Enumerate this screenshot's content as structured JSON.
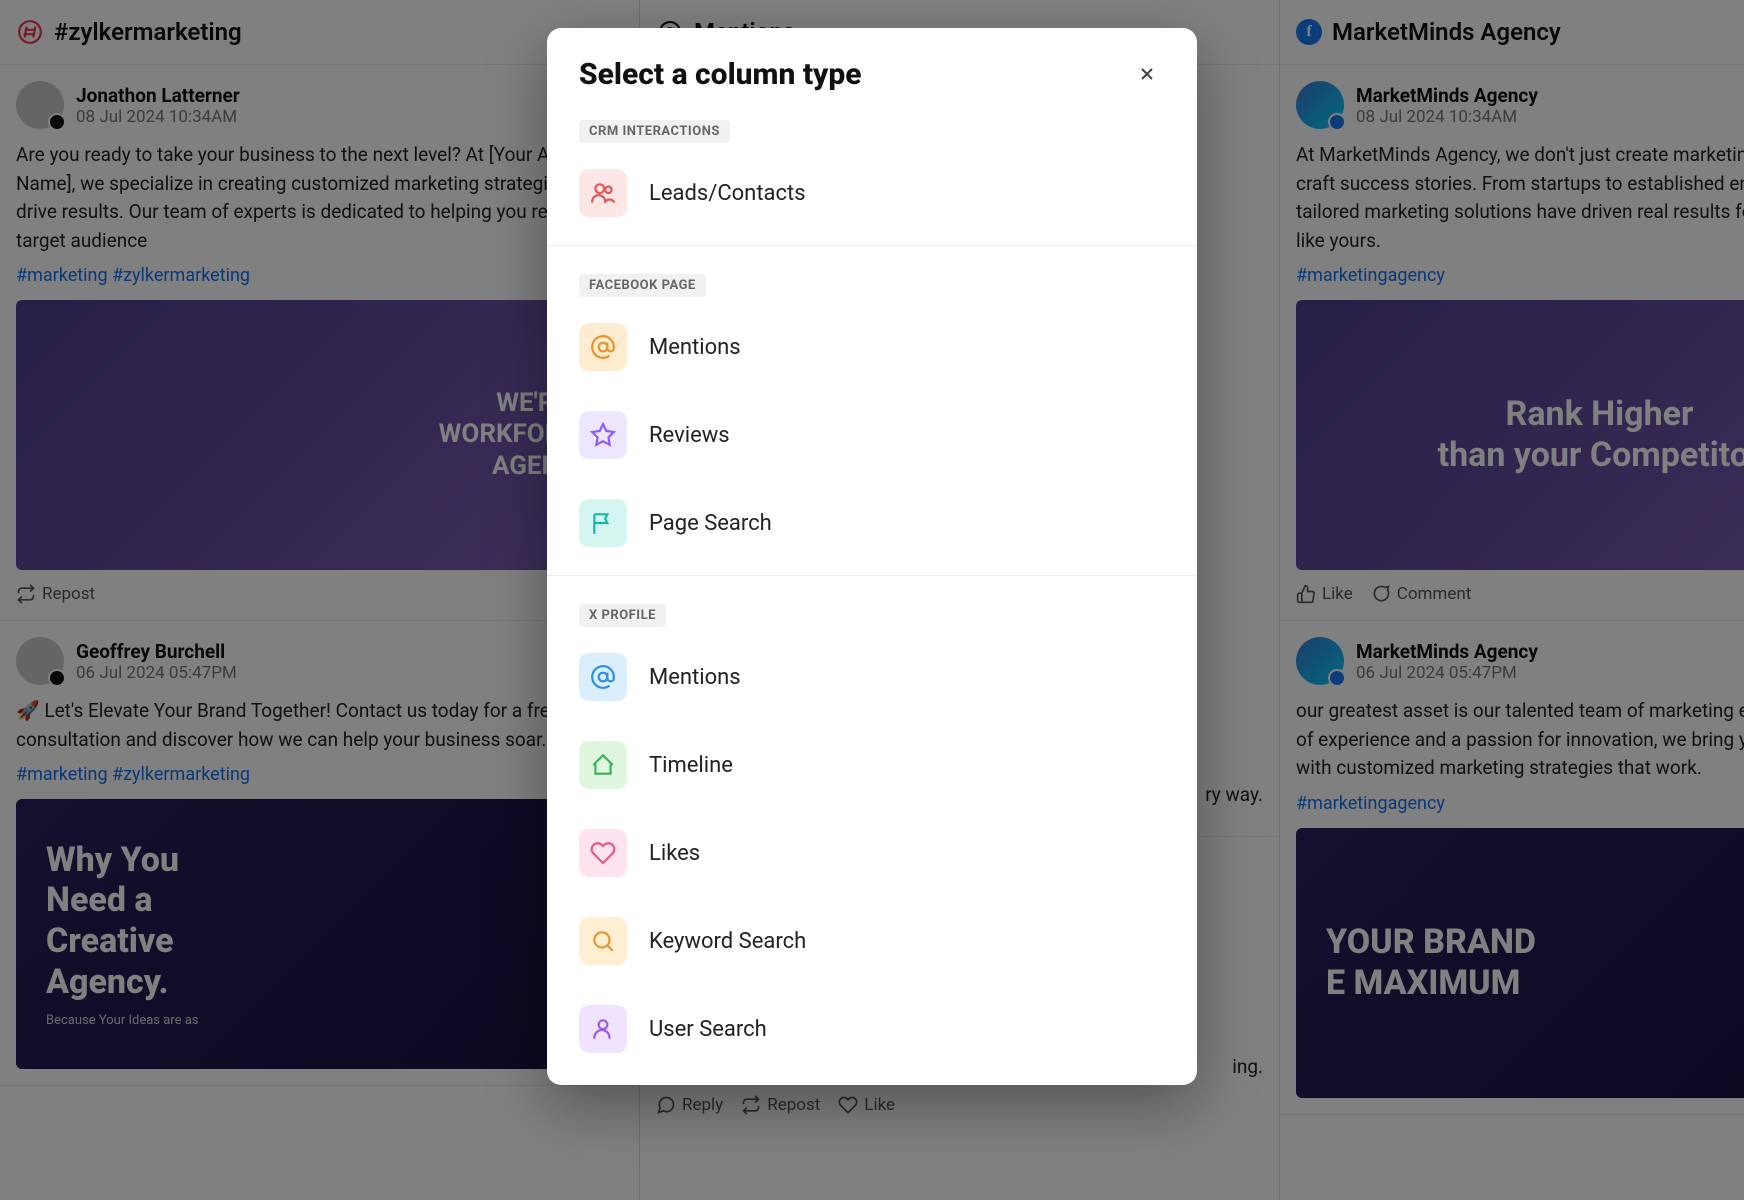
{
  "columns": [
    {
      "title": "#zylkermarketing",
      "icon": "hashtag-icon",
      "posts": [
        {
          "author": "Jonathon Latterner",
          "timestamp": "08 Jul 2024 10:34AM",
          "body": "Are you ready to take your business to the next level? At [Your Agency Name], we specialize in creating customized marketing strategies that drive results. Our team of experts is dedicated to helping you reach your target audience",
          "hashtags": "#marketing #zylkermarketing",
          "image_text": "WE'RE A\nWORKFORCE\nAGENCY",
          "actions": [
            {
              "icon": "repost-icon",
              "label": "Repost"
            }
          ]
        },
        {
          "author": "Geoffrey Burchell",
          "timestamp": "06 Jul 2024 05:47PM",
          "body": "🚀 Let's Elevate Your Brand Together! Contact us today for a free consultation and discover how we can help your business soar. 🌟",
          "hashtags": "#marketing #zylkermarketing",
          "image_text": "Why You\nNeed a\nCreative\nAgency.",
          "image_sub": "Because Your Ideas are as"
        }
      ]
    },
    {
      "title": "Mentions",
      "icon": "at-icon",
      "posts": [
        {
          "body_snippet_1": "ry way.",
          "body_snippet_2": "ing.",
          "actions": [
            {
              "icon": "reply-icon",
              "label": "Reply"
            },
            {
              "icon": "repost-icon",
              "label": "Repost"
            },
            {
              "icon": "like-icon",
              "label": "Like"
            }
          ]
        }
      ]
    },
    {
      "title": "MarketMinds Agency",
      "icon": "facebook-icon",
      "posts": [
        {
          "author": "MarketMinds Agency",
          "timestamp": "08 Jul 2024 10:34AM",
          "body": "At MarketMinds Agency, we don't just create marketing strategies — we craft success stories. From startups to established enterprises, our tailored marketing solutions have driven real results for businesses just like yours.",
          "hashtags": "#marketingagency",
          "image_text": "Rank Higher\nthan your Competitor",
          "actions": [
            {
              "icon": "like-icon",
              "label": "Like"
            },
            {
              "icon": "comment-icon",
              "label": "Comment"
            }
          ]
        },
        {
          "author": "MarketMinds Agency",
          "timestamp": "06 Jul 2024 05:47PM",
          "body": "our greatest asset is our talented team of marketing experts. With years of experience and a passion for innovation, we bring your vision to life with customized marketing strategies that work.",
          "hashtags": "#marketingagency",
          "image_text": "YOUR BRAND\nE MAXIMUM"
        }
      ]
    }
  ],
  "dialog": {
    "title": "Select a column type",
    "sections": [
      {
        "label": "CRM INTERACTIONS",
        "options": [
          {
            "id": "leads",
            "label": "Leads/Contacts",
            "icon": "people-icon",
            "color": "bg-red"
          }
        ]
      },
      {
        "label": "FACEBOOK PAGE",
        "options": [
          {
            "id": "fb-mentions",
            "label": "Mentions",
            "icon": "at-icon",
            "color": "bg-orange"
          },
          {
            "id": "fb-reviews",
            "label": "Reviews",
            "icon": "star-icon",
            "color": "bg-purple"
          },
          {
            "id": "fb-pagesearch",
            "label": "Page Search",
            "icon": "flag-icon",
            "color": "bg-teal"
          }
        ]
      },
      {
        "label": "X PROFILE",
        "options": [
          {
            "id": "x-mentions",
            "label": "Mentions",
            "icon": "at-icon",
            "color": "bg-blue"
          },
          {
            "id": "x-timeline",
            "label": "Timeline",
            "icon": "home-icon",
            "color": "bg-green"
          },
          {
            "id": "x-likes",
            "label": "Likes",
            "icon": "heart-icon",
            "color": "bg-pink"
          },
          {
            "id": "x-keyword",
            "label": "Keyword Search",
            "icon": "search-icon",
            "color": "bg-amber"
          },
          {
            "id": "x-user",
            "label": "User Search",
            "icon": "user-icon",
            "color": "bg-violet"
          }
        ]
      }
    ]
  }
}
